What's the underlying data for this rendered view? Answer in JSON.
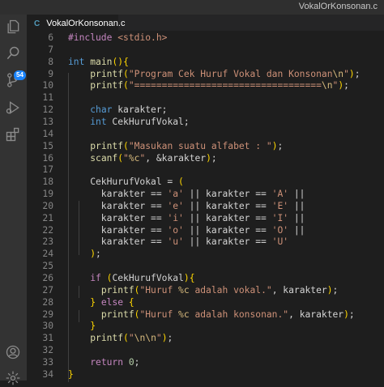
{
  "window": {
    "title": "VokalOrKonsonan.c"
  },
  "activity_bar": {
    "items": [
      {
        "name": "explorer-icon"
      },
      {
        "name": "search-icon"
      },
      {
        "name": "source-control-icon",
        "badge": "54"
      },
      {
        "name": "run-debug-icon"
      },
      {
        "name": "extensions-icon"
      },
      {
        "name": "account-icon"
      },
      {
        "name": "settings-gear-icon"
      }
    ]
  },
  "tab": {
    "icon_text": "C",
    "label": "VokalOrKonsonan.c"
  },
  "editor": {
    "lines": [
      {
        "n": "6",
        "code": "#include <stdio.h>"
      },
      {
        "n": "7",
        "code": ""
      },
      {
        "n": "8",
        "code": "int main(){"
      },
      {
        "n": "9",
        "code": "    printf(\"Program Cek Huruf Vokal dan Konsonan\\n\");"
      },
      {
        "n": "10",
        "code": "    printf(\"==================================\\n\");"
      },
      {
        "n": "11",
        "code": ""
      },
      {
        "n": "12",
        "code": "    char karakter;"
      },
      {
        "n": "13",
        "code": "    int CekHurufVokal;"
      },
      {
        "n": "14",
        "code": ""
      },
      {
        "n": "15",
        "code": "    printf(\"Masukan suatu alfabet : \");"
      },
      {
        "n": "16",
        "code": "    scanf(\"%c\", &karakter);"
      },
      {
        "n": "17",
        "code": ""
      },
      {
        "n": "18",
        "code": "    CekHurufVokal = ("
      },
      {
        "n": "19",
        "code": "      karakter == 'a' || karakter == 'A' ||"
      },
      {
        "n": "20",
        "code": "      karakter == 'e' || karakter == 'E' ||"
      },
      {
        "n": "21",
        "code": "      karakter == 'i' || karakter == 'I' ||"
      },
      {
        "n": "22",
        "code": "      karakter == 'o' || karakter == 'O' ||"
      },
      {
        "n": "23",
        "code": "      karakter == 'u' || karakter == 'U'"
      },
      {
        "n": "24",
        "code": "    );"
      },
      {
        "n": "25",
        "code": ""
      },
      {
        "n": "26",
        "code": "    if (CekHurufVokal){"
      },
      {
        "n": "27",
        "code": "      printf(\"Huruf %c adalah vokal.\", karakter);"
      },
      {
        "n": "28",
        "code": "    } else {"
      },
      {
        "n": "29",
        "code": "      printf(\"Huruf %c adalah konsonan.\", karakter);"
      },
      {
        "n": "30",
        "code": "    }"
      },
      {
        "n": "31",
        "code": "    printf(\"\\n\\n\");"
      },
      {
        "n": "32",
        "code": ""
      },
      {
        "n": "33",
        "code": "    return 0;"
      },
      {
        "n": "34",
        "code": "}"
      }
    ]
  }
}
